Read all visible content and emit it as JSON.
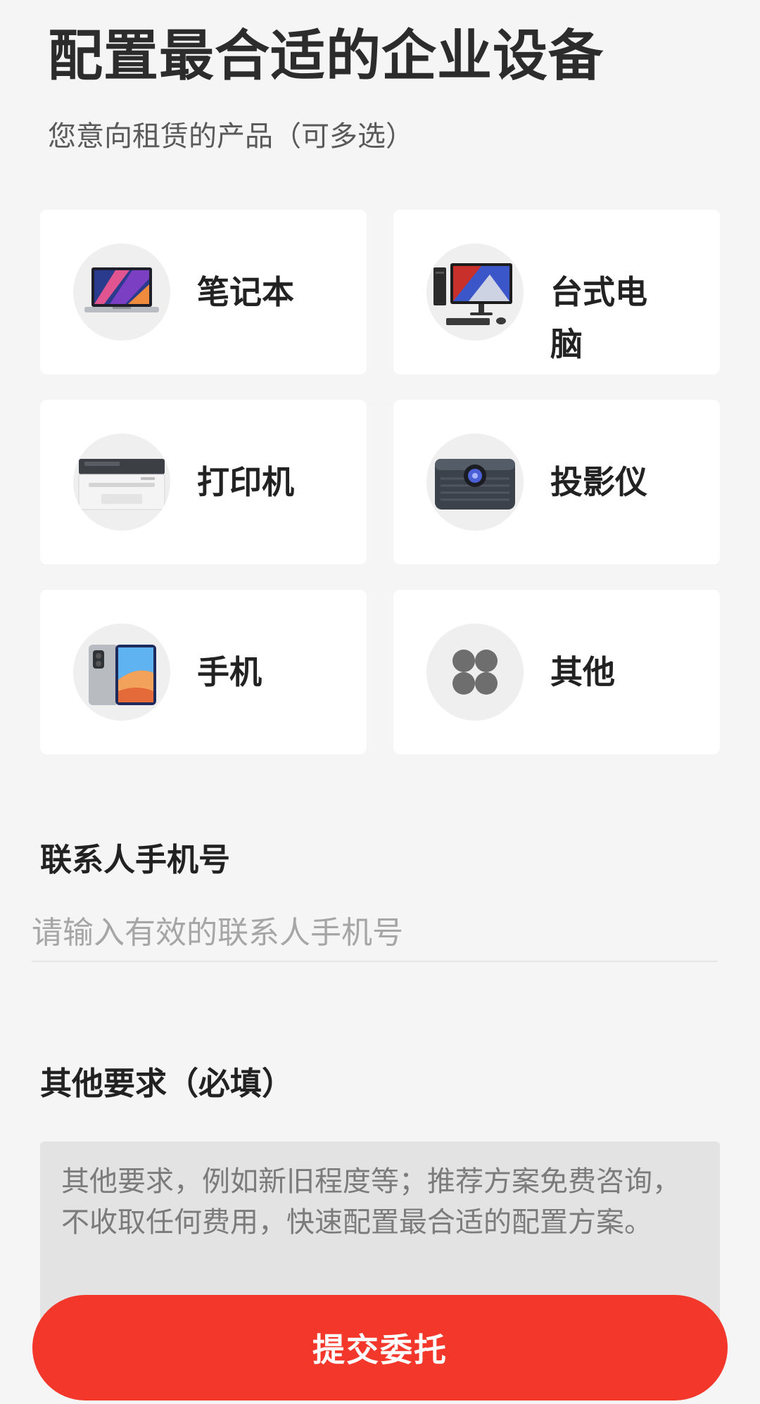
{
  "header": {
    "title": "配置最合适的企业设备",
    "subtitle": "您意向租赁的产品（可多选）"
  },
  "products": [
    {
      "label": "笔记本",
      "icon": "laptop-icon"
    },
    {
      "label": "台式电脑",
      "icon": "desktop-computer-icon"
    },
    {
      "label": "打印机",
      "icon": "printer-icon"
    },
    {
      "label": "投影仪",
      "icon": "projector-icon"
    },
    {
      "label": "手机",
      "icon": "phone-icon"
    },
    {
      "label": "其他",
      "icon": "four-dots-icon"
    }
  ],
  "contact": {
    "label": "联系人手机号",
    "placeholder": "请输入有效的联系人手机号",
    "value": ""
  },
  "requirements": {
    "label": "其他要求（必填）",
    "placeholder": "其他要求，例如新旧程度等；推荐方案免费咨询，不收取任何费用，快速配置最合适的配置方案。",
    "value": ""
  },
  "submit": {
    "label": "提交委托"
  },
  "colors": {
    "accent": "#f4372b",
    "background": "#f5f5f5",
    "card": "#ffffff",
    "textarea_bg": "#e3e3e3"
  }
}
